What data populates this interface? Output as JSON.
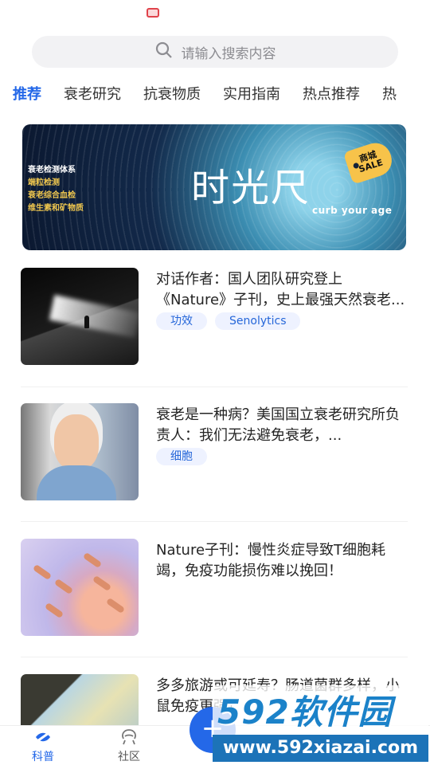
{
  "search": {
    "placeholder": "请输入搜索内容"
  },
  "tabs": [
    {
      "label": "推荐",
      "active": true
    },
    {
      "label": "衰老研究"
    },
    {
      "label": "抗衰物质"
    },
    {
      "label": "实用指南"
    },
    {
      "label": "热点推荐"
    },
    {
      "label": "热"
    }
  ],
  "banner": {
    "left_lines": [
      "衰老检测体系",
      "端粒检测",
      "衰老综合血检",
      "维生素和矿物质"
    ],
    "title": "时光尺",
    "slogan": "curb your age",
    "tag_top": "商城",
    "tag_bottom": "SALE"
  },
  "articles": [
    {
      "title": "对话作者：国人团队研究登上《Nature》子刊，史上最强天然衰老...",
      "tags": [
        "功效",
        "Senolytics"
      ]
    },
    {
      "title": "衰老是一种病？美国国立衰老研究所负责人：我们无法避免衰老，...",
      "tags": [
        "细胞"
      ]
    },
    {
      "title": "Nature子刊：慢性炎症导致T细胞耗竭，免疫功能损伤难以挽回！",
      "tags": []
    },
    {
      "title": "多多旅游或可延寿？肠道菌群多样，小鼠免疫更强！",
      "tags": []
    }
  ],
  "bottom_nav": [
    {
      "label": "科普",
      "icon": "science-icon",
      "active": true
    },
    {
      "label": "社区",
      "icon": "community-icon",
      "active": false
    }
  ],
  "fab": {
    "label": "+"
  },
  "watermark": {
    "top": "592软件园",
    "bottom": "www.592xiazai.com"
  },
  "colors": {
    "accent": "#2468e8",
    "chip_bg": "#eef2ff",
    "chip_text": "#2667d9",
    "banner_gold": "#f1c84f"
  }
}
